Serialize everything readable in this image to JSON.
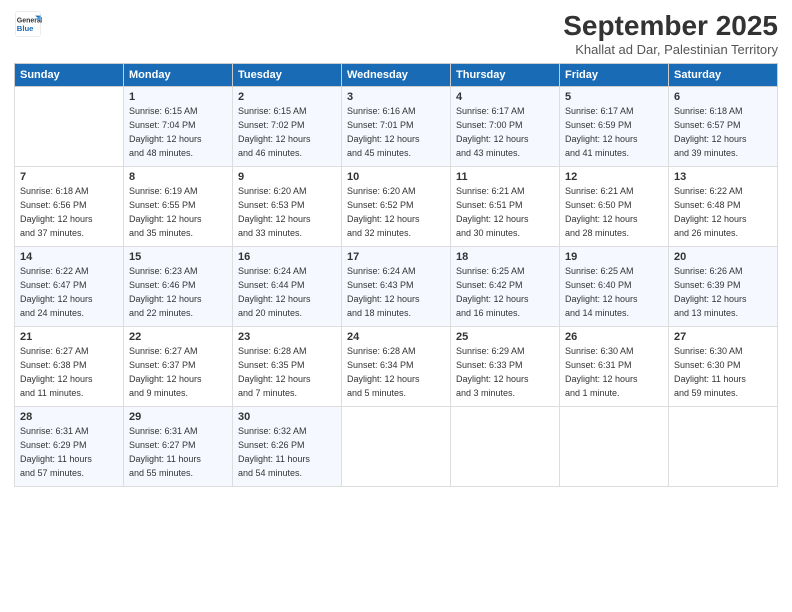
{
  "logo": {
    "line1": "General",
    "line2": "Blue"
  },
  "title": "September 2025",
  "subtitle": "Khallat ad Dar, Palestinian Territory",
  "days_of_week": [
    "Sunday",
    "Monday",
    "Tuesday",
    "Wednesday",
    "Thursday",
    "Friday",
    "Saturday"
  ],
  "weeks": [
    [
      {
        "day": "",
        "info": ""
      },
      {
        "day": "1",
        "info": "Sunrise: 6:15 AM\nSunset: 7:04 PM\nDaylight: 12 hours\nand 48 minutes."
      },
      {
        "day": "2",
        "info": "Sunrise: 6:15 AM\nSunset: 7:02 PM\nDaylight: 12 hours\nand 46 minutes."
      },
      {
        "day": "3",
        "info": "Sunrise: 6:16 AM\nSunset: 7:01 PM\nDaylight: 12 hours\nand 45 minutes."
      },
      {
        "day": "4",
        "info": "Sunrise: 6:17 AM\nSunset: 7:00 PM\nDaylight: 12 hours\nand 43 minutes."
      },
      {
        "day": "5",
        "info": "Sunrise: 6:17 AM\nSunset: 6:59 PM\nDaylight: 12 hours\nand 41 minutes."
      },
      {
        "day": "6",
        "info": "Sunrise: 6:18 AM\nSunset: 6:57 PM\nDaylight: 12 hours\nand 39 minutes."
      }
    ],
    [
      {
        "day": "7",
        "info": "Sunrise: 6:18 AM\nSunset: 6:56 PM\nDaylight: 12 hours\nand 37 minutes."
      },
      {
        "day": "8",
        "info": "Sunrise: 6:19 AM\nSunset: 6:55 PM\nDaylight: 12 hours\nand 35 minutes."
      },
      {
        "day": "9",
        "info": "Sunrise: 6:20 AM\nSunset: 6:53 PM\nDaylight: 12 hours\nand 33 minutes."
      },
      {
        "day": "10",
        "info": "Sunrise: 6:20 AM\nSunset: 6:52 PM\nDaylight: 12 hours\nand 32 minutes."
      },
      {
        "day": "11",
        "info": "Sunrise: 6:21 AM\nSunset: 6:51 PM\nDaylight: 12 hours\nand 30 minutes."
      },
      {
        "day": "12",
        "info": "Sunrise: 6:21 AM\nSunset: 6:50 PM\nDaylight: 12 hours\nand 28 minutes."
      },
      {
        "day": "13",
        "info": "Sunrise: 6:22 AM\nSunset: 6:48 PM\nDaylight: 12 hours\nand 26 minutes."
      }
    ],
    [
      {
        "day": "14",
        "info": "Sunrise: 6:22 AM\nSunset: 6:47 PM\nDaylight: 12 hours\nand 24 minutes."
      },
      {
        "day": "15",
        "info": "Sunrise: 6:23 AM\nSunset: 6:46 PM\nDaylight: 12 hours\nand 22 minutes."
      },
      {
        "day": "16",
        "info": "Sunrise: 6:24 AM\nSunset: 6:44 PM\nDaylight: 12 hours\nand 20 minutes."
      },
      {
        "day": "17",
        "info": "Sunrise: 6:24 AM\nSunset: 6:43 PM\nDaylight: 12 hours\nand 18 minutes."
      },
      {
        "day": "18",
        "info": "Sunrise: 6:25 AM\nSunset: 6:42 PM\nDaylight: 12 hours\nand 16 minutes."
      },
      {
        "day": "19",
        "info": "Sunrise: 6:25 AM\nSunset: 6:40 PM\nDaylight: 12 hours\nand 14 minutes."
      },
      {
        "day": "20",
        "info": "Sunrise: 6:26 AM\nSunset: 6:39 PM\nDaylight: 12 hours\nand 13 minutes."
      }
    ],
    [
      {
        "day": "21",
        "info": "Sunrise: 6:27 AM\nSunset: 6:38 PM\nDaylight: 12 hours\nand 11 minutes."
      },
      {
        "day": "22",
        "info": "Sunrise: 6:27 AM\nSunset: 6:37 PM\nDaylight: 12 hours\nand 9 minutes."
      },
      {
        "day": "23",
        "info": "Sunrise: 6:28 AM\nSunset: 6:35 PM\nDaylight: 12 hours\nand 7 minutes."
      },
      {
        "day": "24",
        "info": "Sunrise: 6:28 AM\nSunset: 6:34 PM\nDaylight: 12 hours\nand 5 minutes."
      },
      {
        "day": "25",
        "info": "Sunrise: 6:29 AM\nSunset: 6:33 PM\nDaylight: 12 hours\nand 3 minutes."
      },
      {
        "day": "26",
        "info": "Sunrise: 6:30 AM\nSunset: 6:31 PM\nDaylight: 12 hours\nand 1 minute."
      },
      {
        "day": "27",
        "info": "Sunrise: 6:30 AM\nSunset: 6:30 PM\nDaylight: 11 hours\nand 59 minutes."
      }
    ],
    [
      {
        "day": "28",
        "info": "Sunrise: 6:31 AM\nSunset: 6:29 PM\nDaylight: 11 hours\nand 57 minutes."
      },
      {
        "day": "29",
        "info": "Sunrise: 6:31 AM\nSunset: 6:27 PM\nDaylight: 11 hours\nand 55 minutes."
      },
      {
        "day": "30",
        "info": "Sunrise: 6:32 AM\nSunset: 6:26 PM\nDaylight: 11 hours\nand 54 minutes."
      },
      {
        "day": "",
        "info": ""
      },
      {
        "day": "",
        "info": ""
      },
      {
        "day": "",
        "info": ""
      },
      {
        "day": "",
        "info": ""
      }
    ]
  ]
}
